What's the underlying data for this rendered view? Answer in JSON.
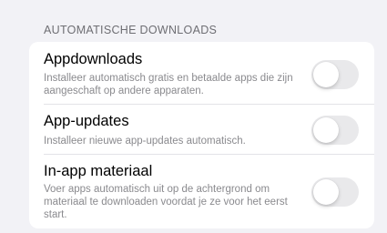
{
  "section": {
    "header": "AUTOMATISCHE DOWNLOADS"
  },
  "rows": [
    {
      "title": "Appdownloads",
      "subtitle": "Installeer automatisch gratis en betaalde apps die zijn aangeschaft op andere apparaten.",
      "toggle_on": false
    },
    {
      "title": "App-updates",
      "subtitle": "Installeer nieuwe app-updates automatisch.",
      "toggle_on": false
    },
    {
      "title": "In-app materiaal",
      "subtitle": "Voer apps automatisch uit op de achtergrond om materiaal te downloaden voordat je ze voor het eerst start.",
      "toggle_on": false
    }
  ],
  "colors": {
    "background": "#f2f2f6",
    "card": "#ffffff",
    "toggle_off": "#e9e9eb",
    "secondary_text": "#8a8a8e"
  }
}
